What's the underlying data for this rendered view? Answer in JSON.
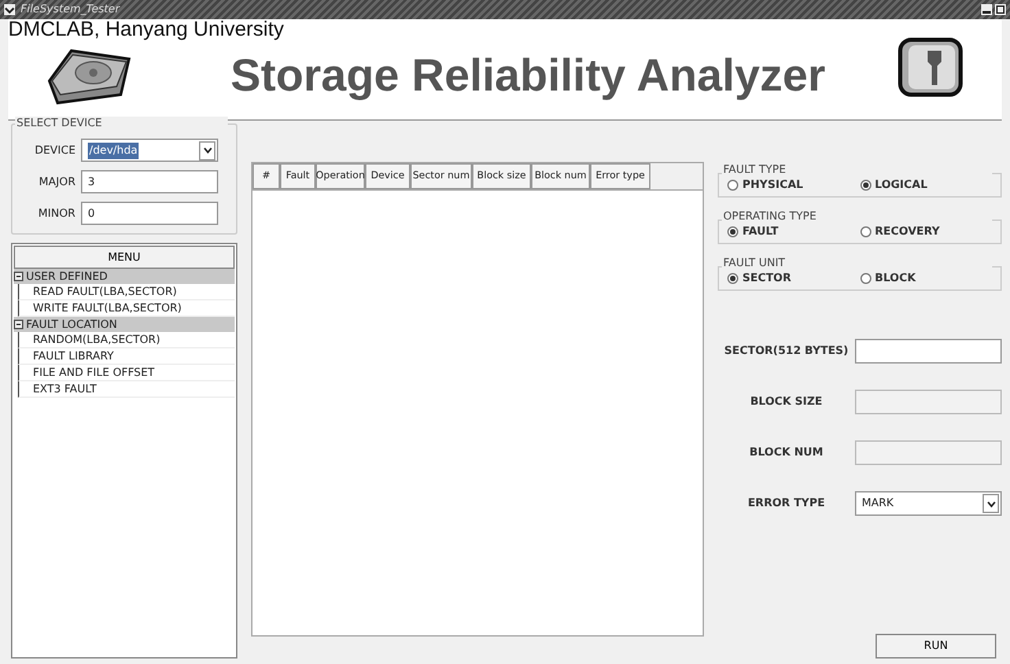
{
  "window": {
    "title": "FileSystem_Tester"
  },
  "header": {
    "org": "DMCLAB, Hanyang University",
    "title": "Storage Reliability Analyzer"
  },
  "select_device": {
    "legend": "SELECT DEVICE",
    "fields": [
      {
        "label": "DEVICE",
        "kind": "dropdown",
        "value": "/dev/hda"
      },
      {
        "label": "MAJOR",
        "kind": "text",
        "value": "3"
      },
      {
        "label": "MINOR",
        "kind": "text",
        "value": "0"
      }
    ]
  },
  "menu": {
    "title": "MENU",
    "tree": [
      {
        "label": "USER DEFINED",
        "expanded": true,
        "children": [
          {
            "label": "READ FAULT(LBA,SECTOR)"
          },
          {
            "label": "WRITE FAULT(LBA,SECTOR)"
          }
        ]
      },
      {
        "label": "FAULT LOCATION",
        "expanded": true,
        "children": [
          {
            "label": "RANDOM(LBA,SECTOR)"
          },
          {
            "label": "FAULT LIBRARY"
          },
          {
            "label": "FILE AND FILE OFFSET"
          },
          {
            "label": "EXT3 FAULT"
          }
        ]
      }
    ]
  },
  "table": {
    "columns": [
      "#",
      "Fault",
      "Operation",
      "Device",
      "Sector num",
      "Block size",
      "Block num",
      "Error type"
    ]
  },
  "radio_groups": [
    {
      "legend": "FAULT TYPE",
      "options": [
        {
          "label": "PHYSICAL",
          "selected": false
        },
        {
          "label": "LOGICAL",
          "selected": true
        }
      ]
    },
    {
      "legend": "OPERATING TYPE",
      "options": [
        {
          "label": "FAULT",
          "selected": true
        },
        {
          "label": "RECOVERY",
          "selected": false
        }
      ]
    },
    {
      "legend": "FAULT UNIT",
      "options": [
        {
          "label": "SECTOR",
          "selected": true
        },
        {
          "label": "BLOCK",
          "selected": false
        }
      ]
    }
  ],
  "params": [
    {
      "label": "SECTOR(512 BYTES)",
      "kind": "text",
      "disabled": false
    },
    {
      "label": "BLOCK SIZE",
      "kind": "text",
      "disabled": true
    },
    {
      "label": "BLOCK NUM",
      "kind": "text",
      "disabled": true
    },
    {
      "label": "ERROR TYPE",
      "kind": "dropdown",
      "value": "MARK",
      "disabled": false
    }
  ],
  "buttons": [
    "RUN"
  ]
}
